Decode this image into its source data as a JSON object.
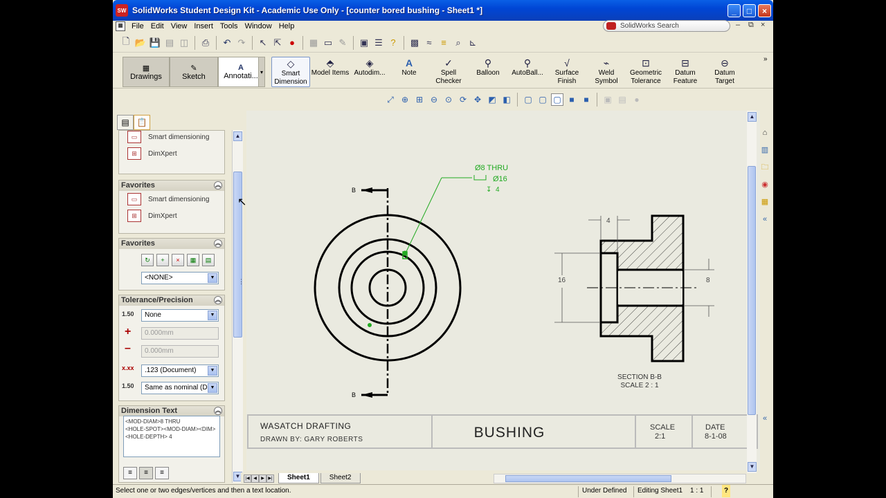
{
  "window": {
    "title": "SolidWorks Student Design Kit - Academic Use Only - [counter bored bushing - Sheet1 *]",
    "app_icon": "SW"
  },
  "menu": {
    "items": [
      "File",
      "Edit",
      "View",
      "Insert",
      "Tools",
      "Window",
      "Help"
    ],
    "search_placeholder": "SolidWorks Search"
  },
  "command_manager": {
    "tabs": [
      "Drawings",
      "Sketch",
      "Annotati..."
    ],
    "buttons": [
      {
        "label": "Smart Dimension",
        "icon": "smart-dimension-icon"
      },
      {
        "label": "Model Items",
        "icon": "model-items-icon"
      },
      {
        "label": "Autodim...",
        "icon": "autodimension-icon"
      },
      {
        "label": "Note",
        "icon": "note-icon"
      },
      {
        "label": "Spell Checker",
        "icon": "spell-checker-icon"
      },
      {
        "label": "Balloon",
        "icon": "balloon-icon"
      },
      {
        "label": "AutoBall...",
        "icon": "auto-balloon-icon"
      },
      {
        "label": "Surface Finish",
        "icon": "surface-finish-icon"
      },
      {
        "label": "Weld Symbol",
        "icon": "weld-symbol-icon"
      },
      {
        "label": "Geometric Tolerance",
        "icon": "geometric-tolerance-icon"
      },
      {
        "label": "Datum Feature",
        "icon": "datum-feature-icon"
      },
      {
        "label": "Datum Target",
        "icon": "datum-target-icon"
      }
    ]
  },
  "left_pane": {
    "top_items": [
      "Smart dimensioning",
      "DimXpert"
    ],
    "favorites1": {
      "title": "Favorites",
      "items": [
        "Smart dimensioning",
        "DimXpert"
      ]
    },
    "favorites2": {
      "title": "Favorites",
      "select_value": "<NONE>"
    },
    "tolerance": {
      "title": "Tolerance/Precision",
      "tolerance_type": "None",
      "plus_value": "0.000mm",
      "minus_value": "0.000mm",
      "precision": ".123 (Document)",
      "tol_precision": "Same as nominal (D"
    },
    "dimension_text": {
      "title": "Dimension Text",
      "lines": [
        "<MOD-DIAM>8 THRU",
        "<HOLE-SPOT><MOD-DIAM><DIM>",
        "<HOLE-DEPTH> 4"
      ]
    }
  },
  "drawing": {
    "hole_callout": [
      "Ø8 THRU",
      "Ø16",
      "4"
    ],
    "section_label_top": "B",
    "section_label_bottom": "B",
    "section_dim_top": "4",
    "section_dim_left": "16",
    "section_dim_right": "8",
    "section_title": "SECTION B-B",
    "section_scale": "SCALE 2 : 1",
    "title_block": {
      "company": "WASATCH DRAFTING",
      "drawn_by": "DRAWN BY:  GARY ROBERTS",
      "part_name": "BUSHING",
      "scale_label": "SCALE",
      "scale_value": "2:1",
      "date_label": "DATE",
      "date_value": "8-1-08"
    }
  },
  "sheets": [
    "Sheet1",
    "Sheet2"
  ],
  "status": {
    "message": "Select one or two edges/vertices and then a text location.",
    "state": "Under Defined",
    "editing": "Editing Sheet1",
    "scale": "1 : 1",
    "help": "?"
  },
  "colors": {
    "annotation_green": "#22aa22",
    "titlebar_blue": "#0046d5"
  }
}
